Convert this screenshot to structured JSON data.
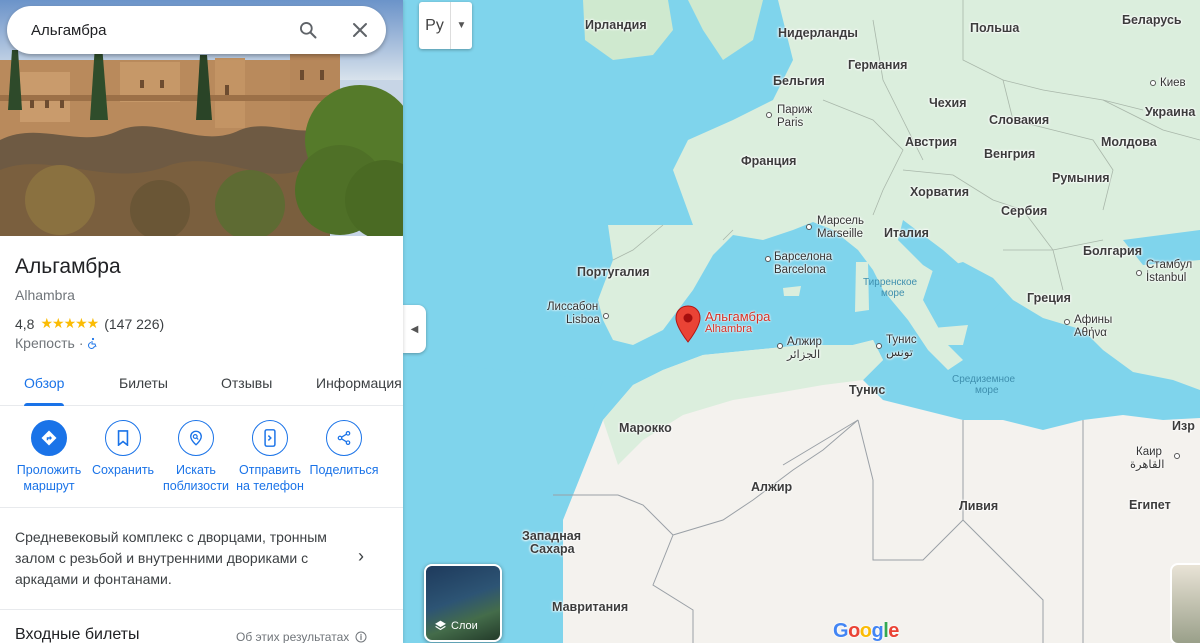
{
  "search": {
    "value": "Альгамбра"
  },
  "place": {
    "name": "Альгамбра",
    "latin_name": "Alhambra",
    "rating": "4,8",
    "stars": 5,
    "reviews": "(147 226)",
    "category": "Крепость",
    "separator": "·"
  },
  "tabs": [
    "Обзор",
    "Билеты",
    "Отзывы",
    "Информация"
  ],
  "actions": [
    {
      "line1": "Проложить",
      "line2": "маршрут",
      "icon": "directions-icon"
    },
    {
      "line1": "Сохранить",
      "line2": "",
      "icon": "bookmark-icon"
    },
    {
      "line1": "Искать",
      "line2": "поблизости",
      "icon": "nearby-icon"
    },
    {
      "line1": "Отправить",
      "line2": "на телефон",
      "icon": "send-to-phone-icon"
    },
    {
      "line1": "Поделиться",
      "line2": "",
      "icon": "share-icon"
    }
  ],
  "description": "Средневековый комплекс с дворцами, тронным залом с резьбой и внутренними двориками с аркадами и фонтанами.",
  "tickets": {
    "heading": "Входные билеты",
    "note": "Об этих результатах"
  },
  "map": {
    "language_button": "Ру",
    "layers_label": "Слои",
    "pin": {
      "name": "Альгамбра",
      "latin": "Alhambra"
    },
    "countries": {
      "ireland": "Ирландия",
      "netherlands": "Нидерланды",
      "belgium": "Бельгия",
      "germany": "Германия",
      "poland": "Польша",
      "belarus": "Беларусь",
      "czech": "Чехия",
      "slovakia": "Словакия",
      "austria": "Австрия",
      "hungary": "Венгрия",
      "ukraine": "Украина",
      "moldova": "Молдова",
      "romania": "Румыния",
      "france": "Франция",
      "croatia": "Хорватия",
      "serbia": "Сербия",
      "italy": "Италия",
      "bulgaria": "Болгария",
      "portugal": "Португалия",
      "greece": "Греция",
      "tunisia": "Тунис",
      "morocco": "Марокко",
      "algeria": "Алжир",
      "libya": "Ливия",
      "egypt": "Египет",
      "western_sahara_1": "Западная",
      "western_sahara_2": "Сахара",
      "mauritania": "Мавритания",
      "israel_cut": "Изр"
    },
    "cities": {
      "paris_ru": "Париж",
      "paris": "Paris",
      "marseille_ru": "Марсель",
      "marseille": "Marseille",
      "barcelona_ru": "Барселона",
      "barcelona": "Barcelona",
      "lisbon_ru": "Лиссабон",
      "lisbon": "Lisboa",
      "kyiv": "Киев",
      "istanbul_ru": "Стамбул",
      "istanbul": "İstanbul",
      "athens_ru": "Афины",
      "athens": "Αθήνα",
      "algiers_ru": "Алжир",
      "algiers": "الجزائر",
      "tunis_ru": "Тунис",
      "tunis": "تونس",
      "cairo_ru": "Каир",
      "cairo": "القاهرة"
    },
    "seas": {
      "tyrrhenian_1": "Тирренское",
      "tyrrhenian_2": "море",
      "med_1": "Средиземное",
      "med_2": "море"
    },
    "google_logo": "Google"
  },
  "colors": {
    "accent": "#1a73e8",
    "star": "#fbbc04",
    "pin": "#ea4335",
    "water": "#7fd4ec",
    "land": "#dbeedd",
    "desert": "#f4f2ee"
  }
}
